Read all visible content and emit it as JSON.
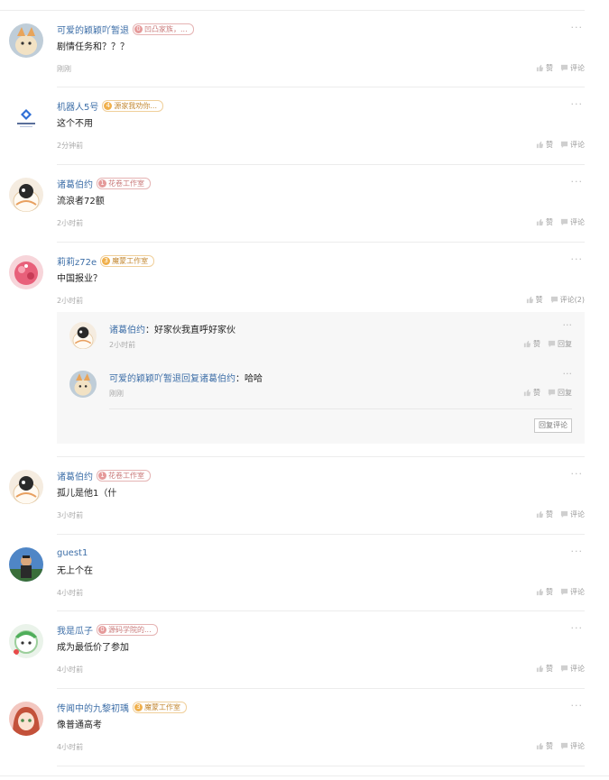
{
  "comments": [
    {
      "name": "可爱的颖颖吖暂退",
      "badge": {
        "level": "0",
        "text": "凹凸家族，...",
        "color": "#c97a7a",
        "bg": "#e59a9a"
      },
      "text": "剧情任务和？？？",
      "time": "刚刚",
      "like": "赞",
      "comment": "评论"
    },
    {
      "name": "机器人5号",
      "badge": {
        "level": "4",
        "text": "源家我劝你...",
        "color": "#e0a03c",
        "bg": "#f0b04c"
      },
      "text": "这个不用",
      "time": "2分钟前",
      "like": "赞",
      "comment": "评论"
    },
    {
      "name": "诸葛伯约",
      "badge": {
        "level": "1",
        "text": "花卷工作室",
        "color": "#c97a7a",
        "bg": "#e59a9a"
      },
      "text": "流浪者72额",
      "time": "2小时前",
      "like": "赞",
      "comment": "评论"
    },
    {
      "name": "莉莉z72e",
      "badge": {
        "level": "3",
        "text": "魔蒙工作室",
        "color": "#e0a03c",
        "bg": "#f0b04c"
      },
      "text": "中国报业？",
      "time": "2小时前",
      "like": "赞",
      "comment": "评论(2)",
      "replies": [
        {
          "name": "诸葛伯约",
          "sep": "：",
          "text": "好家伙我直呼好家伙",
          "time": "2小时前",
          "like": "赞",
          "reply": "回复"
        },
        {
          "name": "可爱的颖颖吖暂退回复诸葛伯约",
          "sep": "：",
          "text": "哈哈",
          "time": "刚刚",
          "like": "赞",
          "reply": "回复"
        }
      ],
      "reply_button": "回复评论"
    },
    {
      "name": "诸葛伯约",
      "badge": {
        "level": "1",
        "text": "花卷工作室",
        "color": "#c97a7a",
        "bg": "#e59a9a"
      },
      "text": "孤儿是他1（什",
      "time": "3小时前",
      "like": "赞",
      "comment": "评论"
    },
    {
      "name": "guest1",
      "text": "无上个在",
      "time": "4小时前",
      "like": "赞",
      "comment": "评论"
    },
    {
      "name": "我是瓜子",
      "badge": {
        "level": "0",
        "text": "源码学院的...",
        "color": "#c97a7a",
        "bg": "#e59a9a"
      },
      "text": "成为最低价了参加",
      "time": "4小时前",
      "like": "赞",
      "comment": "评论"
    },
    {
      "name": "传闻中的九黎初瑀",
      "badge": {
        "level": "3",
        "text": "魔蒙工作室",
        "color": "#e0a03c",
        "bg": "#f0b04c"
      },
      "text": "像普通高考",
      "time": "4小时前",
      "like": "赞",
      "comment": "评论"
    }
  ],
  "more_glyph": "···"
}
